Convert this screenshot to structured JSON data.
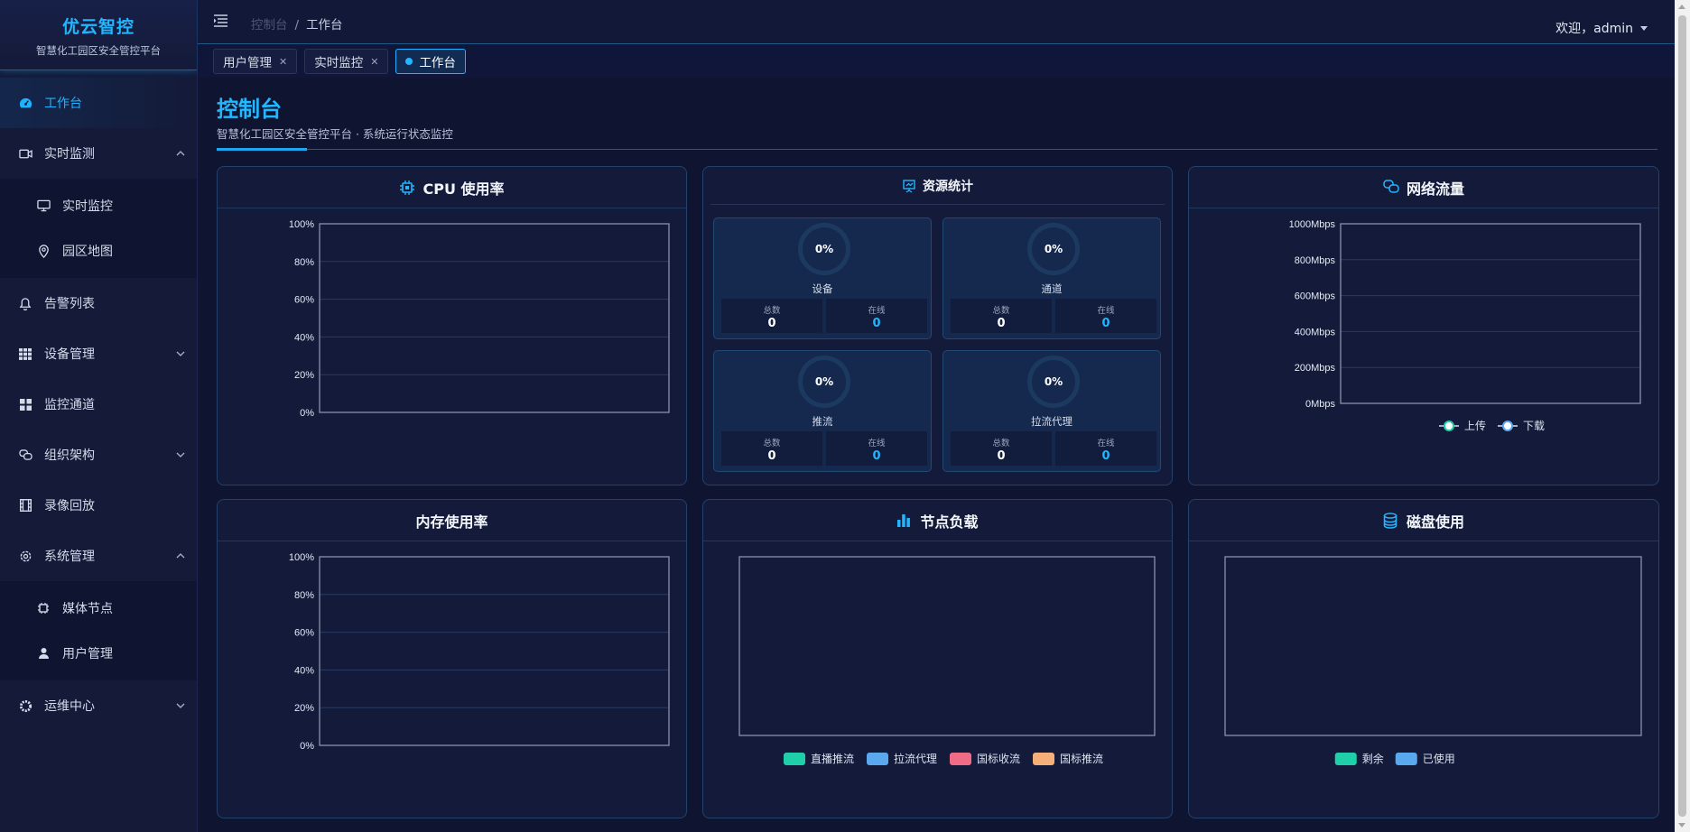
{
  "brand": {
    "title": "优云智控",
    "subtitle": "智慧化工园区安全管控平台"
  },
  "sidebar": {
    "items": [
      {
        "label": "工作台",
        "icon": "dashboard-icon",
        "active": true
      },
      {
        "label": "实时监测",
        "icon": "video-camera-icon",
        "expanded": true,
        "children": [
          {
            "label": "实时监控",
            "icon": "monitor-icon"
          },
          {
            "label": "园区地图",
            "icon": "map-pin-icon"
          }
        ]
      },
      {
        "label": "告警列表",
        "icon": "bell-icon"
      },
      {
        "label": "设备管理",
        "icon": "grid-table-icon",
        "expanded": false
      },
      {
        "label": "监控通道",
        "icon": "four-squares-icon"
      },
      {
        "label": "组织架构",
        "icon": "chat-bubbles-icon",
        "expanded": false
      },
      {
        "label": "录像回放",
        "icon": "film-icon"
      },
      {
        "label": "系统管理",
        "icon": "gear-outline-icon",
        "expanded": true,
        "children": [
          {
            "label": "媒体节点",
            "icon": "chip-icon"
          },
          {
            "label": "用户管理",
            "icon": "user-icon"
          }
        ]
      },
      {
        "label": "运维中心",
        "icon": "gear-solid-icon",
        "expanded": false
      }
    ]
  },
  "topbar": {
    "breadcrumb": [
      "控制台",
      "工作台"
    ],
    "separator": "/",
    "welcome": "欢迎，admin"
  },
  "tabs": [
    {
      "label": "用户管理",
      "closable": true,
      "active": false
    },
    {
      "label": "实时监控",
      "closable": true,
      "active": false
    },
    {
      "label": "工作台",
      "closable": false,
      "active": true
    }
  ],
  "page": {
    "title": "控制台",
    "subtitle": "智慧化工园区安全管控平台 · 系统运行状态监控"
  },
  "cards": {
    "cpu": {
      "title": "CPU 使用率"
    },
    "resources": {
      "title": "资源统计",
      "items": [
        {
          "name": "设备",
          "percent": "0%",
          "total_label": "总数",
          "total": "0",
          "online_label": "在线",
          "online": "0"
        },
        {
          "name": "通道",
          "percent": "0%",
          "total_label": "总数",
          "total": "0",
          "online_label": "在线",
          "online": "0"
        },
        {
          "name": "推流",
          "percent": "0%",
          "total_label": "总数",
          "total": "0",
          "online_label": "在线",
          "online": "0"
        },
        {
          "name": "拉流代理",
          "percent": "0%",
          "total_label": "总数",
          "total": "0",
          "online_label": "在线",
          "online": "0"
        }
      ]
    },
    "network": {
      "title": "网络流量"
    },
    "memory": {
      "title": "内存使用率"
    },
    "node_load": {
      "title": "节点负载"
    },
    "disk": {
      "title": "磁盘使用"
    }
  },
  "colors": {
    "accent": "#22b6ff",
    "teal": "#1fcfa9",
    "blue": "#5aa9ee",
    "pink": "#f06b86",
    "orange": "#f5b07a"
  },
  "chart_data": [
    {
      "id": "cpu",
      "type": "line",
      "yticks": [
        "100%",
        "80%",
        "60%",
        "40%",
        "20%",
        "0%"
      ],
      "ylim": [
        0,
        100
      ],
      "series": []
    },
    {
      "id": "network",
      "type": "line",
      "yticks": [
        "1000Mbps",
        "800Mbps",
        "600Mbps",
        "400Mbps",
        "200Mbps",
        "0Mbps"
      ],
      "ylim": [
        0,
        1000
      ],
      "series": [
        {
          "name": "上传",
          "values": []
        },
        {
          "name": "下载",
          "values": []
        }
      ],
      "legend": "bottom"
    },
    {
      "id": "memory",
      "type": "line",
      "yticks": [
        "100%",
        "80%",
        "60%",
        "40%",
        "20%",
        "0%"
      ],
      "ylim": [
        0,
        100
      ],
      "series": []
    },
    {
      "id": "node_load",
      "type": "bar",
      "series": [
        {
          "name": "直播推流",
          "values": []
        },
        {
          "name": "拉流代理",
          "values": []
        },
        {
          "name": "国标收流",
          "values": []
        },
        {
          "name": "国标推流",
          "values": []
        }
      ],
      "legend": "bottom"
    },
    {
      "id": "disk",
      "type": "bar",
      "series": [
        {
          "name": "剩余",
          "values": []
        },
        {
          "name": "已使用",
          "values": []
        }
      ],
      "legend": "bottom"
    }
  ]
}
